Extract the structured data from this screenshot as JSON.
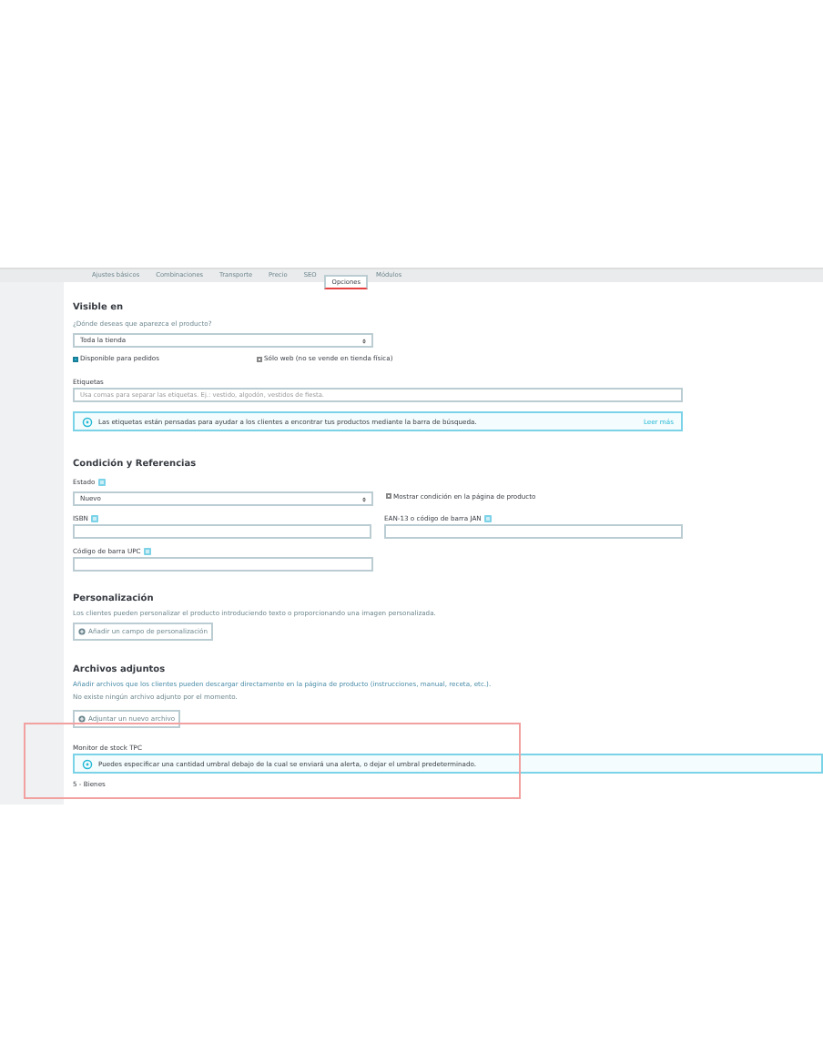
{
  "tabs": [
    {
      "label": "Ajustes básicos",
      "selected": false
    },
    {
      "label": "Combinaciones",
      "selected": false
    },
    {
      "label": "Transporte",
      "selected": false
    },
    {
      "label": "Precio",
      "selected": false
    },
    {
      "label": "SEO",
      "selected": false
    },
    {
      "label": "Opciones",
      "selected": true
    },
    {
      "label": "Módulos",
      "selected": false
    }
  ],
  "visibility": {
    "title": "Visible en",
    "hint": "¿Dónde deseas que aparezca el producto?",
    "select": "Toda la tienda",
    "checkboxes": [
      {
        "label": "Disponible para pedidos",
        "checked": true
      },
      {
        "label": "Sólo web (no se vende en tienda física)",
        "checked": false
      }
    ],
    "tags_label": "Etiquetas",
    "tags_placeholder": "Usa comas para separar las etiquetas. Ej.: vestido, algodón, vestidos de fiesta.",
    "alert": "Las etiquetas están pensadas para ayudar a los clientes a encontrar tus productos mediante la barra de búsqueda.",
    "alert_link": "Leer más"
  },
  "condition": {
    "title": "Condición y Referencias",
    "state_label": "Estado",
    "state_value": "Nuevo",
    "show_condition": {
      "label": "Mostrar condición en la página de producto",
      "checked": false
    },
    "isbn_label": "ISBN",
    "ean_label": "EAN-13 o código de barra JAN",
    "upc_label": "Código de barra UPC"
  },
  "customization": {
    "title": "Personalización",
    "description": "Los clientes pueden personalizar el producto introduciendo texto o proporcionando una imagen personalizada.",
    "button": "Añadir un campo de personalización"
  },
  "attachments": {
    "title": "Archivos adjuntos",
    "description": "Añadir archivos que los clientes pueden descargar directamente en la página de producto (instrucciones, manual, receta, etc.).",
    "empty": "No existe ningún archivo adjunto por el momento.",
    "button": "Adjuntar un nuevo archivo"
  },
  "stock": {
    "label": "Monitor de stock TPC",
    "alert": "Puedes especificar una cantidad umbral debajo de la cual se enviará una alerta, o dejar el umbral predeterminado.",
    "value": "5 - Bienes"
  }
}
